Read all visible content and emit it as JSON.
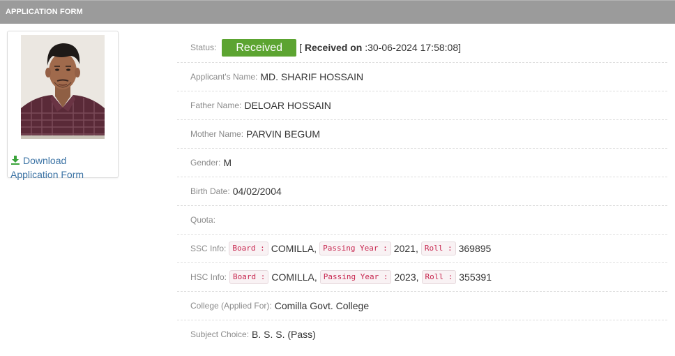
{
  "header": {
    "title": "APPLICATION FORM"
  },
  "sidebar": {
    "download_label": "Download Application Form"
  },
  "status": {
    "label": "Status:",
    "badge": "Received",
    "received_on_prefix": "[ ",
    "received_on_bold": "Received on",
    "received_on_value": " :30-06-2024 17:58:08]",
    "badge_color": "#5ca431"
  },
  "fields": {
    "applicant": {
      "label": "Applicant's Name:",
      "value": "MD. SHARIF HOSSAIN"
    },
    "father": {
      "label": "Father Name:",
      "value": "DELOAR HOSSAIN"
    },
    "mother": {
      "label": "Mother Name:",
      "value": "PARVIN BEGUM"
    },
    "gender": {
      "label": "Gender:",
      "value": "M"
    },
    "birth": {
      "label": "Birth Date:",
      "value": "04/02/2004"
    },
    "quota": {
      "label": "Quota:",
      "value": ""
    },
    "ssc": {
      "label": "SSC Info:",
      "board_tag": "Board :",
      "board": "COMILLA,",
      "year_tag": "Passing Year :",
      "year": "2021,",
      "roll_tag": "Roll :",
      "roll": "369895"
    },
    "hsc": {
      "label": "HSC Info:",
      "board_tag": "Board :",
      "board": "COMILLA,",
      "year_tag": "Passing Year :",
      "year": "2023,",
      "roll_tag": "Roll :",
      "roll": "355391"
    },
    "college": {
      "label": "College (Applied For):",
      "value": "Comilla Govt. College"
    },
    "subject": {
      "label": "Subject Choice:",
      "value": "B. S. S. (Pass)"
    }
  },
  "icons": {
    "download": "download-icon"
  }
}
